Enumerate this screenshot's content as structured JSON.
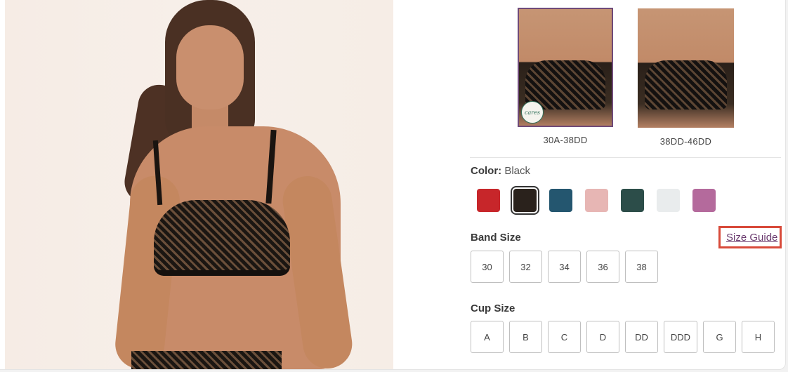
{
  "hero": {
    "alt": "Model wearing black lace strapless bra"
  },
  "thumbnails": [
    {
      "label": "30A-38DD",
      "selected": true,
      "badge": "cares"
    },
    {
      "label": "38DD-46DD",
      "selected": false
    }
  ],
  "color": {
    "label": "Color:",
    "value": "Black",
    "swatches": [
      {
        "name": "red",
        "hex": "#c7262a"
      },
      {
        "name": "black",
        "hex": "#2a221c",
        "selected": true
      },
      {
        "name": "teal-blue",
        "hex": "#24566f"
      },
      {
        "name": "blush-pink",
        "hex": "#e7b6b4"
      },
      {
        "name": "dark-green",
        "hex": "#2c4d49"
      },
      {
        "name": "white",
        "hex": "#e9eced"
      },
      {
        "name": "orchid",
        "hex": "#b46a9c"
      }
    ]
  },
  "band": {
    "title": "Band Size",
    "size_guide": "Size Guide",
    "sizes": [
      "30",
      "32",
      "34",
      "36",
      "38"
    ]
  },
  "cup": {
    "title": "Cup Size",
    "sizes": [
      "A",
      "B",
      "C",
      "D",
      "DD",
      "DDD",
      "G",
      "H"
    ]
  }
}
